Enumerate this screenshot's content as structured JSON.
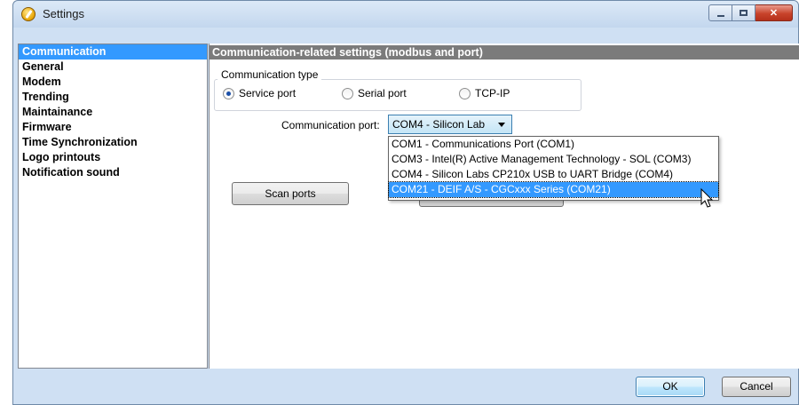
{
  "window": {
    "title": "Settings"
  },
  "sidebar": {
    "items": [
      {
        "label": "Communication",
        "selected": true
      },
      {
        "label": "General"
      },
      {
        "label": "Modem"
      },
      {
        "label": "Trending"
      },
      {
        "label": "Maintainance"
      },
      {
        "label": "Firmware"
      },
      {
        "label": "Time Synchronization"
      },
      {
        "label": "Logo printouts"
      },
      {
        "label": "Notification sound"
      }
    ]
  },
  "main": {
    "header": "Communication-related settings (modbus and port)",
    "comm_type": {
      "legend": "Communication type",
      "options": [
        {
          "label": "Service port",
          "checked": true
        },
        {
          "label": "Serial port",
          "checked": false
        },
        {
          "label": "TCP-IP",
          "checked": false
        }
      ]
    },
    "port": {
      "label": "Communication port:",
      "selected": "COM4 - Silicon Lab",
      "options": [
        "COM1 - Communications Port (COM1)",
        "COM3 - Intel(R) Active Management Technology - SOL (COM3)",
        "COM4 - Silicon Labs CP210x USB to UART Bridge (COM4)",
        "COM21 - DEIF A/S - CGCxxx Series (COM21)"
      ],
      "highlighted_index": 3
    },
    "scan_button": "Scan ports"
  },
  "footer": {
    "ok_label": "OK",
    "cancel_label": "Cancel"
  },
  "colors": {
    "selection": "#3399ff",
    "header_bg": "#7b7b7b",
    "window_bg": "#cfe0f3"
  }
}
